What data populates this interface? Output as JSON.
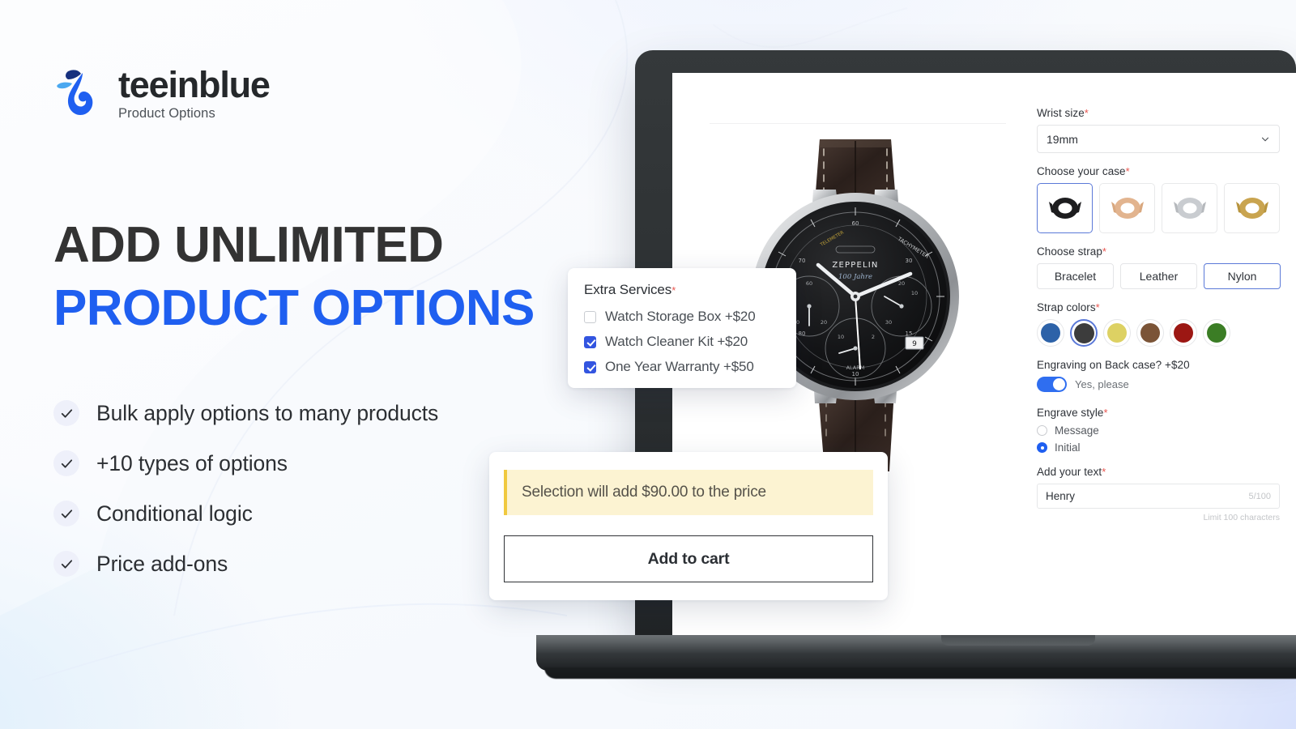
{
  "brand": {
    "name": "teeinblue",
    "tagline": "Product Options",
    "mark_icon": "teeinblue-droplet-logo",
    "colors": {
      "primary": "#1f5ff0",
      "dark": "#16307e",
      "light": "#4aa8f0"
    }
  },
  "headline": {
    "line1": "ADD UNLIMITED",
    "line2": "PRODUCT OPTIONS",
    "line1_color": "#333333",
    "line2_color": "#1f5ff0"
  },
  "features": [
    {
      "icon": "check-icon",
      "label": "Bulk apply options to many products"
    },
    {
      "icon": "check-icon",
      "label": "+10 types of options"
    },
    {
      "icon": "check-icon",
      "label": "Conditional logic"
    },
    {
      "icon": "check-icon",
      "label": "Price add-ons"
    }
  ],
  "product": {
    "image_alt": "Zeppelin chronograph wristwatch with black dial and dark leather strap"
  },
  "options_panel": {
    "wrist_size": {
      "label": "Wrist size",
      "required_mark": "*",
      "value": "19mm",
      "chevron_icon": "chevron-down-icon"
    },
    "case": {
      "label": "Choose your case",
      "required_mark": "*",
      "items": [
        {
          "name": "black-case",
          "color": "#252525",
          "selected": true
        },
        {
          "name": "rose-gold-case",
          "color": "#e2b48f",
          "selected": false
        },
        {
          "name": "silver-case",
          "color": "#c9ccd0",
          "selected": false
        },
        {
          "name": "gold-case",
          "color": "#c9a44f",
          "selected": false
        }
      ]
    },
    "strap": {
      "label": "Choose strap",
      "required_mark": "*",
      "options": [
        {
          "label": "Bracelet",
          "selected": false
        },
        {
          "label": "Leather",
          "selected": false
        },
        {
          "label": "Nylon",
          "selected": true
        }
      ]
    },
    "strap_colors": {
      "label": "Strap colors",
      "required_mark": "*",
      "swatches": [
        {
          "name": "blue",
          "hex": "#2d62a8",
          "selected": false
        },
        {
          "name": "black",
          "hex": "#3c3c3c",
          "selected": true
        },
        {
          "name": "yellow",
          "hex": "#ddd163",
          "selected": false
        },
        {
          "name": "brown",
          "hex": "#7b5437",
          "selected": false
        },
        {
          "name": "red",
          "hex": "#9c1713",
          "selected": false
        },
        {
          "name": "green",
          "hex": "#3b7d25",
          "selected": false
        }
      ]
    },
    "engraving": {
      "label": "Engraving on Back case? +$20",
      "toggle_on": true,
      "toggle_text": "Yes, please"
    },
    "engrave_style": {
      "label": "Engrave style",
      "required_mark": "*",
      "options": [
        {
          "label": "Message",
          "selected": false
        },
        {
          "label": "Initial",
          "selected": true
        }
      ]
    },
    "add_text": {
      "label": "Add your text",
      "required_mark": "*",
      "value": "Henry",
      "counter": "5/100",
      "hint": "Limit 100 characters"
    }
  },
  "extra_services": {
    "title": "Extra Services",
    "required_mark": "*",
    "items": [
      {
        "label": "Watch Storage Box +$20",
        "checked": false
      },
      {
        "label": "Watch Cleaner Kit +$20",
        "checked": true
      },
      {
        "label": "One Year Warranty +$50",
        "checked": true
      }
    ]
  },
  "cart": {
    "price_note": "Selection will add $90.00 to the price",
    "button_label": "Add to cart",
    "banner_bg": "#fcf3d2",
    "banner_accent": "#f0c93f"
  }
}
